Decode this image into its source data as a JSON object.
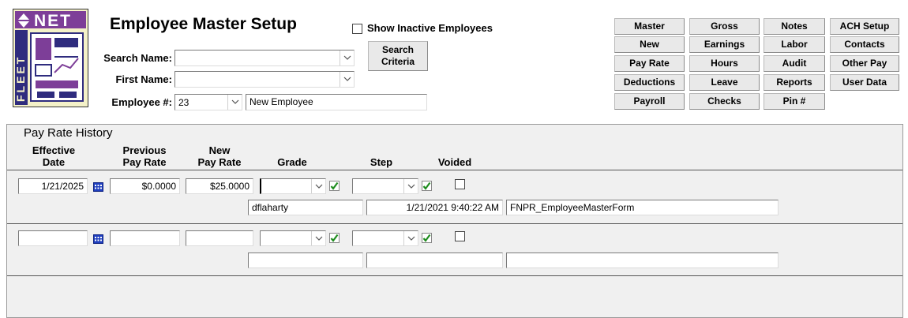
{
  "header": {
    "title": "Employee Master Setup",
    "show_inactive_label": "Show Inactive Employees",
    "search_name_label": "Search Name:",
    "first_name_label": "First Name:",
    "employee_num_label": "Employee #:",
    "search_name_value": "",
    "first_name_value": "",
    "employee_num_value": "23",
    "employee_name_value": "New Employee",
    "search_criteria_label": "Search\nCriteria"
  },
  "logo_text": "NET FLEET",
  "buttons": [
    [
      "Master",
      "Gross",
      "Notes",
      "ACH Setup"
    ],
    [
      "New",
      "Earnings",
      "Labor",
      "Contacts"
    ],
    [
      "Pay Rate",
      "Hours",
      "Audit",
      "Other Pay"
    ],
    [
      "Deductions",
      "Leave",
      "Reports",
      "User Data"
    ],
    [
      "Payroll",
      "Checks",
      "Pin #",
      ""
    ]
  ],
  "pay_rate": {
    "title": "Pay Rate History",
    "columns": {
      "effective_date": "Effective\nDate",
      "previous_pay_rate": "Previous\nPay Rate",
      "new_pay_rate": "New\nPay Rate",
      "grade": "Grade",
      "step": "Step",
      "voided": "Voided"
    },
    "rows": [
      {
        "effective_date": "1/21/2025",
        "previous_pay_rate": "$0.0000",
        "new_pay_rate": "$25.0000",
        "grade": "",
        "step": "",
        "user": "dflaharty",
        "timestamp": "1/21/2021 9:40:22 AM",
        "source": "FNPR_EmployeeMasterForm"
      },
      {
        "effective_date": "",
        "previous_pay_rate": "",
        "new_pay_rate": "",
        "grade": "",
        "step": "",
        "user": "",
        "timestamp": "",
        "source": ""
      }
    ]
  },
  "colors": {
    "panel_bg": "#f0f0f0",
    "button_bg": "#e9e9e9",
    "check_green": "#1e8c1e",
    "calendar_blue": "#1f3fbf"
  }
}
